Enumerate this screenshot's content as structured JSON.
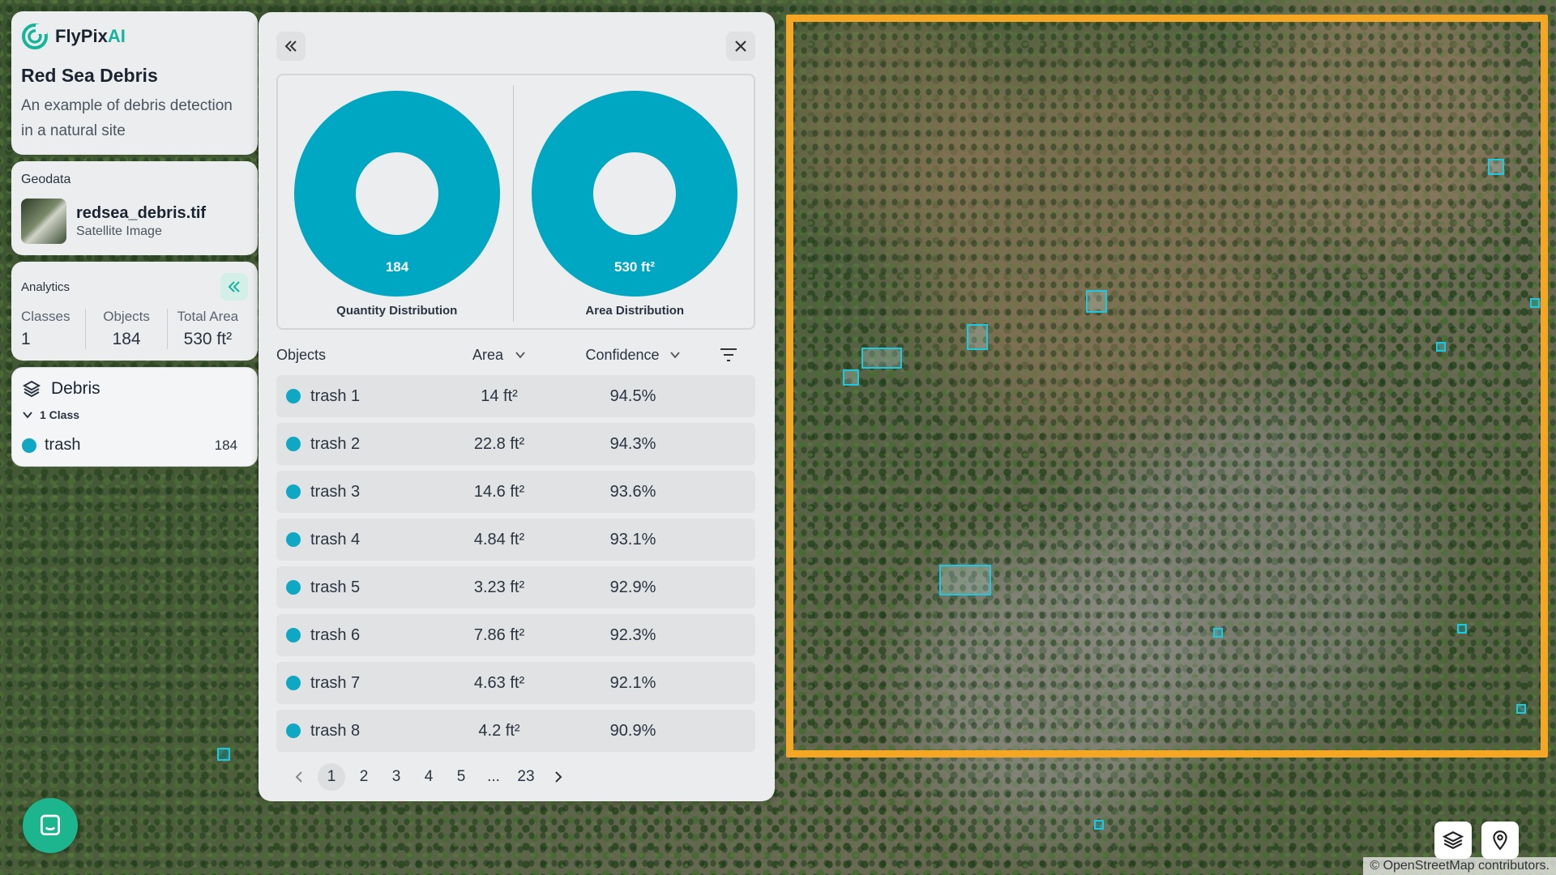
{
  "brand": {
    "name": "FlyPix",
    "name_suffix": "AI",
    "accent": "#14b59a"
  },
  "project": {
    "title": "Red Sea Debris",
    "description": "An example of debris detection in a natural site"
  },
  "geodata": {
    "label": "Geodata",
    "file_name": "redsea_debris.tif",
    "file_type": "Satellite Image"
  },
  "analytics": {
    "label": "Analytics",
    "stats": [
      {
        "label": "Classes",
        "value": "1"
      },
      {
        "label": "Objects",
        "value": "184"
      },
      {
        "label": "Total Area",
        "value": "530 ft²"
      }
    ]
  },
  "debris": {
    "title": "Debris",
    "class_count": "1 Class",
    "classes": [
      {
        "name": "trash",
        "count": "184",
        "color": "#0fa8c4"
      }
    ]
  },
  "charts": {
    "color": "#00a7c2",
    "quantity": {
      "value_label": "184",
      "title": "Quantity Distribution"
    },
    "area": {
      "value_label": "530 ft²",
      "title": "Area Distribution"
    }
  },
  "table": {
    "headers": {
      "objects": "Objects",
      "area": "Area",
      "confidence": "Confidence"
    },
    "rows": [
      {
        "name": "trash 1",
        "area": "14 ft²",
        "confidence": "94.5%"
      },
      {
        "name": "trash 2",
        "area": "22.8 ft²",
        "confidence": "94.3%"
      },
      {
        "name": "trash 3",
        "area": "14.6 ft²",
        "confidence": "93.6%"
      },
      {
        "name": "trash 4",
        "area": "4.84 ft²",
        "confidence": "93.1%"
      },
      {
        "name": "trash 5",
        "area": "3.23 ft²",
        "confidence": "92.9%"
      },
      {
        "name": "trash 6",
        "area": "7.86 ft²",
        "confidence": "92.3%"
      },
      {
        "name": "trash 7",
        "area": "4.63 ft²",
        "confidence": "92.1%"
      },
      {
        "name": "trash 8",
        "area": "4.2 ft²",
        "confidence": "90.9%"
      }
    ]
  },
  "pagination": {
    "pages": [
      "1",
      "2",
      "3",
      "4",
      "5",
      "...",
      "23"
    ],
    "current": "1"
  },
  "map": {
    "attribution": "© OpenStreetMap contributors.",
    "highlight_color": "#f5a623",
    "detection_color": "#1ec8e0"
  },
  "icons": {
    "logo": "flypix-logo-icon",
    "collapse": "double-chevron-left-icon",
    "close": "close-icon",
    "layers": "layers-icon",
    "location": "location-pin-icon",
    "chat": "chat-icon",
    "filter": "filter-icon",
    "sort": "chevron-down-icon"
  }
}
